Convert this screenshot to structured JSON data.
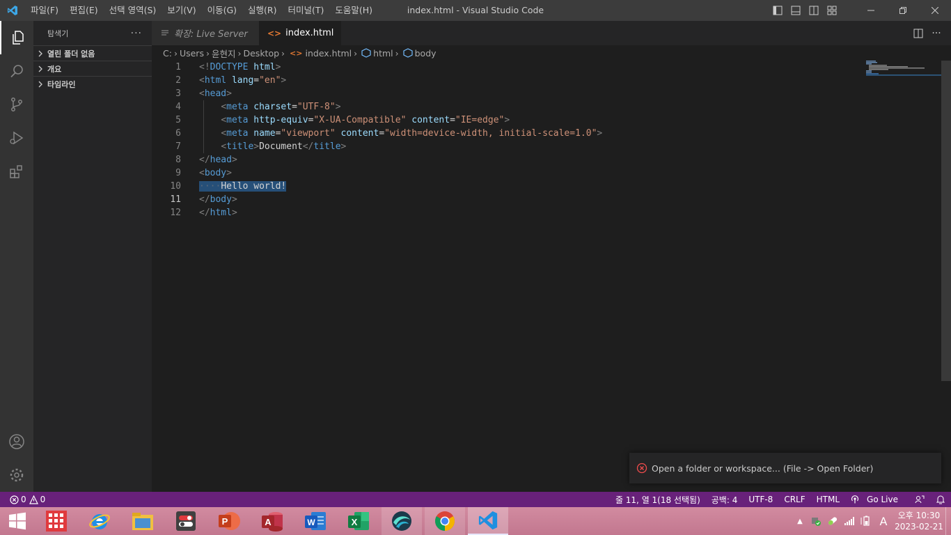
{
  "titlebar": {
    "menu": [
      "파일(F)",
      "편집(E)",
      "선택 영역(S)",
      "보기(V)",
      "이동(G)",
      "실행(R)",
      "터미널(T)",
      "도움말(H)"
    ],
    "title": "index.html - Visual Studio Code"
  },
  "sidebar": {
    "title": "탐색기",
    "sections": [
      "열린 폴더 없음",
      "개요",
      "타임라인"
    ]
  },
  "tabs": [
    {
      "label": "확장: Live Server"
    },
    {
      "label": "index.html"
    }
  ],
  "breadcrumb": [
    "C:",
    "Users",
    "윤현지",
    "Desktop",
    "index.html",
    "html",
    "body"
  ],
  "editor": {
    "active_line": 11,
    "lines": [
      {
        "n": "1",
        "tokens": [
          [
            "pu",
            "<!"
          ],
          [
            "tg",
            "DOCTYPE"
          ],
          [
            "tx",
            " "
          ],
          [
            "at",
            "html"
          ],
          [
            "pu",
            ">"
          ]
        ]
      },
      {
        "n": "2",
        "tokens": [
          [
            "pu",
            "<"
          ],
          [
            "tg",
            "html"
          ],
          [
            "tx",
            " "
          ],
          [
            "at",
            "lang"
          ],
          [
            "tx",
            "="
          ],
          [
            "st",
            "\"en\""
          ],
          [
            "pu",
            ">"
          ]
        ]
      },
      {
        "n": "3",
        "tokens": [
          [
            "pu",
            "<"
          ],
          [
            "tg",
            "head"
          ],
          [
            "pu",
            ">"
          ]
        ]
      },
      {
        "n": "4",
        "tokens": [
          [
            "tx",
            "    "
          ],
          [
            "pu",
            "<"
          ],
          [
            "tg",
            "meta"
          ],
          [
            "tx",
            " "
          ],
          [
            "at",
            "charset"
          ],
          [
            "tx",
            "="
          ],
          [
            "st",
            "\"UTF-8\""
          ],
          [
            "pu",
            ">"
          ]
        ]
      },
      {
        "n": "5",
        "tokens": [
          [
            "tx",
            "    "
          ],
          [
            "pu",
            "<"
          ],
          [
            "tg",
            "meta"
          ],
          [
            "tx",
            " "
          ],
          [
            "at",
            "http-equiv"
          ],
          [
            "tx",
            "="
          ],
          [
            "st",
            "\"X-UA-Compatible\""
          ],
          [
            "tx",
            " "
          ],
          [
            "at",
            "content"
          ],
          [
            "tx",
            "="
          ],
          [
            "st",
            "\"IE=edge\""
          ],
          [
            "pu",
            ">"
          ]
        ]
      },
      {
        "n": "6",
        "tokens": [
          [
            "tx",
            "    "
          ],
          [
            "pu",
            "<"
          ],
          [
            "tg",
            "meta"
          ],
          [
            "tx",
            " "
          ],
          [
            "at",
            "name"
          ],
          [
            "tx",
            "="
          ],
          [
            "st",
            "\"viewport\""
          ],
          [
            "tx",
            " "
          ],
          [
            "at",
            "content"
          ],
          [
            "tx",
            "="
          ],
          [
            "st",
            "\"width=device-width, initial-scale=1.0\""
          ],
          [
            "pu",
            ">"
          ]
        ]
      },
      {
        "n": "7",
        "tokens": [
          [
            "tx",
            "    "
          ],
          [
            "pu",
            "<"
          ],
          [
            "tg",
            "title"
          ],
          [
            "pu",
            ">"
          ],
          [
            "tx",
            "Document"
          ],
          [
            "pu",
            "</"
          ],
          [
            "tg",
            "title"
          ],
          [
            "pu",
            ">"
          ]
        ]
      },
      {
        "n": "8",
        "tokens": [
          [
            "pu",
            "</"
          ],
          [
            "tg",
            "head"
          ],
          [
            "pu",
            ">"
          ]
        ]
      },
      {
        "n": "9",
        "tokens": [
          [
            "pu",
            "<"
          ],
          [
            "tg",
            "body"
          ],
          [
            "pu",
            ">"
          ]
        ]
      },
      {
        "n": "10",
        "tokens": [
          [
            "ws sel",
            "····"
          ],
          [
            "tx sel",
            "Hello world!"
          ]
        ]
      },
      {
        "n": "11",
        "tokens": [
          [
            "pu",
            "</"
          ],
          [
            "tg",
            "body"
          ],
          [
            "pu",
            ">"
          ]
        ]
      },
      {
        "n": "12",
        "tokens": [
          [
            "pu",
            "</"
          ],
          [
            "tg",
            "html"
          ],
          [
            "pu",
            ">"
          ]
        ]
      }
    ]
  },
  "notification": {
    "text": "Open a folder or workspace... (File -> Open Folder)"
  },
  "statusbar": {
    "errors": "0",
    "warnings": "0",
    "position": "줄 11, 열 1(18 선택됨)",
    "spaces": "공백: 4",
    "encoding": "UTF-8",
    "eol": "CRLF",
    "language": "HTML",
    "golive": "Go Live"
  },
  "taskbar": {
    "time": "오후 10:30",
    "date": "2023-02-21",
    "ime": "A"
  },
  "colors": {
    "statusbar": "#68217a",
    "accent": "#007acc",
    "error": "#f14c4c"
  }
}
